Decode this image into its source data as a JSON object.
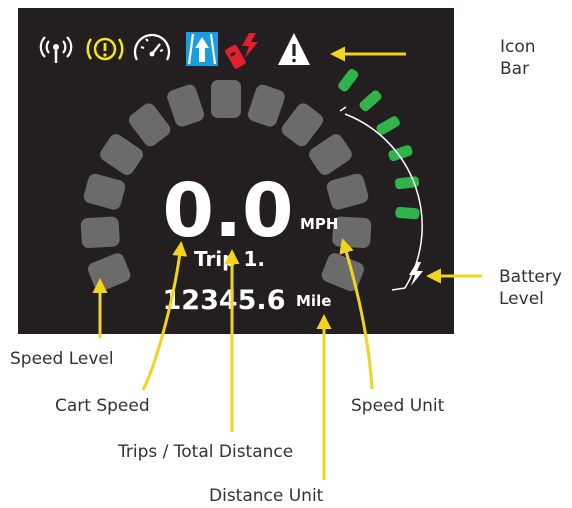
{
  "display": {
    "speed": "0.0",
    "speed_unit": "MPH",
    "trip_label": "Trip 1.",
    "distance": "12345.6",
    "distance_unit": "Mile",
    "speed_level_segments_lit": 0,
    "speed_level_segments_total": 13,
    "battery_level_segments_lit": 6,
    "battery_level_segments_total": 6
  },
  "icon_bar": {
    "icons": [
      "wireless-signal-icon",
      "brake-warning-icon",
      "speedometer-icon",
      "road-lane-icon",
      "remote-key-icon",
      "warning-triangle-icon"
    ]
  },
  "callouts": {
    "icon_bar": [
      "Icon",
      "Bar"
    ],
    "battery_level": [
      "Battery",
      "Level"
    ],
    "speed_level": "Speed Level",
    "cart_speed": "Cart Speed",
    "speed_unit": "Speed Unit",
    "trips_total_distance": "Trips / Total Distance",
    "distance_unit": "Distance Unit"
  },
  "colors": {
    "screen_bg": "#231f20",
    "segment_off": "#6b6b6b",
    "battery_on": "#2fb34a",
    "callout_arrow": "#f2d31d",
    "icon_yellow": "#f5e617",
    "icon_blue": "#1b9be0",
    "icon_red": "#e5202e"
  }
}
